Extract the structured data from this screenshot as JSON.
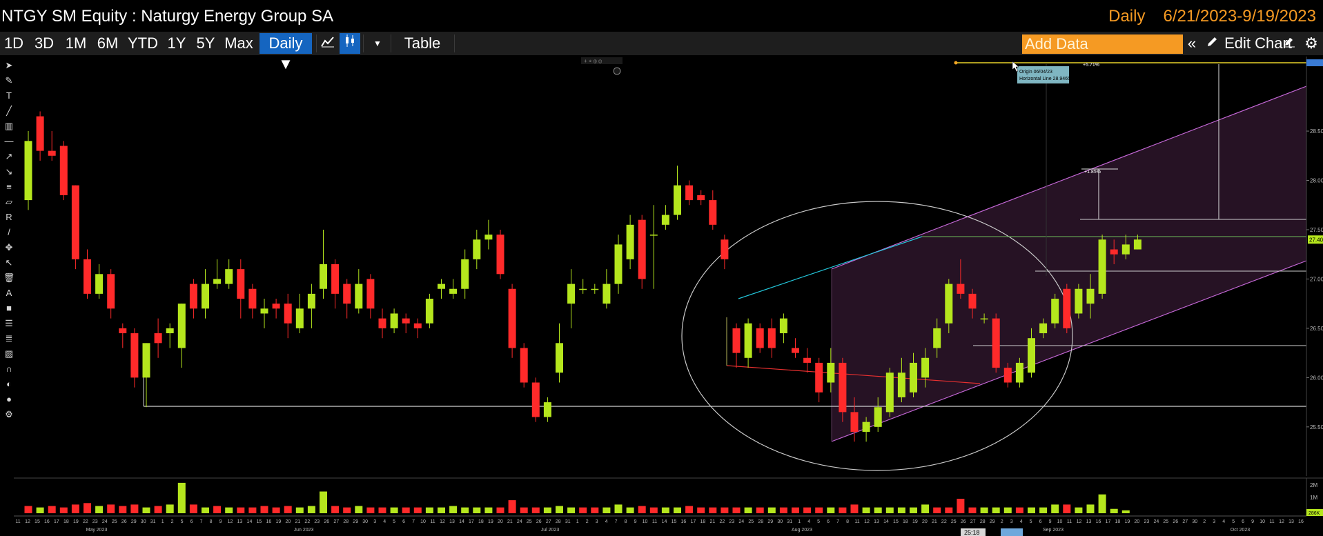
{
  "header": {
    "title": "NTGY SM Equity : Naturgy Energy Group SA",
    "frequency": "Daily",
    "date_range": "6/21/2023-9/19/2023"
  },
  "toolbar": {
    "ranges": [
      "1D",
      "3D",
      "1M",
      "6M",
      "YTD",
      "1Y",
      "5Y",
      "Max"
    ],
    "frequency_dropdown": "Daily ▼",
    "table_label": "Table",
    "add_data_placeholder": "Add Data",
    "edit_chart_label": "Edit Chart"
  },
  "colors": {
    "up": "#b5e61d",
    "down": "#ff2a2a",
    "accent": "#1565c0",
    "add_data_bg": "#f59a23",
    "channel": "#c266d4",
    "ellipse": "#c8c8c8"
  },
  "icons": [
    "line-chart-icon",
    "candle-chart-icon",
    "dropdown-arrow-icon",
    "collapse-icon",
    "pencil-icon",
    "edit-icon",
    "gear-icon"
  ],
  "annotations": {
    "origin_label": "Origin 06/04/23",
    "horizontal_line_label": "Horizontal Line 28.9465",
    "pct_top": "+5.71%",
    "pct_mid": "+1.85%",
    "time_marker": "25:18"
  },
  "chart_data": {
    "type": "candlestick",
    "y_ticks": [
      "28.50",
      "28.00",
      "27.50",
      "27.00",
      "26.50",
      "26.00",
      "25.50"
    ],
    "y_range": [
      25.1,
      29.2
    ],
    "last_price": "27.40",
    "month_labels": [
      "May 2023",
      "Jun 2023",
      "Jul 2023",
      "Aug 2023",
      "Sep 2023",
      "Oct 2023"
    ],
    "x_ticks": [
      "11",
      "12",
      "15",
      "16",
      "17",
      "18",
      "19",
      "22",
      "23",
      "24",
      "25",
      "26",
      "29",
      "30",
      "31",
      "1",
      "2",
      "5",
      "6",
      "7",
      "8",
      "9",
      "12",
      "13",
      "14",
      "15",
      "16",
      "19",
      "20",
      "21",
      "22",
      "23",
      "26",
      "27",
      "28",
      "29",
      "30",
      "3",
      "4",
      "5",
      "6",
      "7",
      "10",
      "11",
      "12",
      "13",
      "14",
      "17",
      "18",
      "19",
      "20",
      "21",
      "24",
      "25",
      "26",
      "27",
      "28",
      "31",
      "1",
      "2",
      "3",
      "4",
      "7",
      "8",
      "9",
      "10",
      "11",
      "14",
      "15",
      "16",
      "17",
      "18",
      "21",
      "22",
      "23",
      "24",
      "25",
      "28",
      "29",
      "30",
      "31",
      "1",
      "4",
      "5",
      "6",
      "7",
      "8",
      "11",
      "12",
      "13",
      "14",
      "15",
      "18",
      "19",
      "20",
      "21",
      "22",
      "25",
      "26",
      "27",
      "28",
      "29",
      "2",
      "3",
      "4",
      "5",
      "6",
      "9",
      "10",
      "11",
      "12",
      "13",
      "16",
      "17",
      "18",
      "19",
      "20",
      "23",
      "24",
      "25",
      "26",
      "27",
      "30",
      "2",
      "3",
      "4",
      "5",
      "6",
      "9",
      "10",
      "11",
      "12",
      "13",
      "16"
    ],
    "volume_ticks": [
      "2M",
      "1M"
    ],
    "volume_last": "286K",
    "candles": [
      {
        "o": 27.8,
        "c": 28.4,
        "h": 28.5,
        "l": 27.7
      },
      {
        "o": 28.65,
        "c": 28.3,
        "h": 28.7,
        "l": 28.2
      },
      {
        "o": 28.3,
        "c": 28.25,
        "h": 28.5,
        "l": 28.2
      },
      {
        "o": 28.35,
        "c": 27.85,
        "h": 28.4,
        "l": 27.8
      },
      {
        "o": 27.95,
        "c": 27.2,
        "h": 27.95,
        "l": 27.1
      },
      {
        "o": 27.2,
        "c": 26.85,
        "h": 27.3,
        "l": 26.8
      },
      {
        "o": 26.85,
        "c": 27.05,
        "h": 27.15,
        "l": 26.8
      },
      {
        "o": 27.05,
        "c": 26.7,
        "h": 27.1,
        "l": 26.6
      },
      {
        "o": 26.5,
        "c": 26.45,
        "h": 26.55,
        "l": 26.3
      },
      {
        "o": 26.45,
        "c": 26.0,
        "h": 26.5,
        "l": 25.9
      },
      {
        "o": 26.0,
        "c": 26.35,
        "h": 26.35,
        "l": 25.7
      },
      {
        "o": 26.45,
        "c": 26.35,
        "h": 26.6,
        "l": 26.2
      },
      {
        "o": 26.45,
        "c": 26.5,
        "h": 26.55,
        "l": 26.3
      },
      {
        "o": 26.3,
        "c": 26.75,
        "h": 26.75,
        "l": 26.1
      },
      {
        "o": 26.95,
        "c": 26.7,
        "h": 27.0,
        "l": 26.6
      },
      {
        "o": 26.7,
        "c": 26.95,
        "h": 27.1,
        "l": 26.6
      },
      {
        "o": 26.95,
        "c": 27.0,
        "h": 27.2,
        "l": 26.9
      },
      {
        "o": 26.95,
        "c": 27.1,
        "h": 27.2,
        "l": 26.9
      },
      {
        "o": 27.1,
        "c": 26.8,
        "h": 27.2,
        "l": 26.6
      },
      {
        "o": 26.9,
        "c": 26.7,
        "h": 26.95,
        "l": 26.6
      },
      {
        "o": 26.65,
        "c": 26.7,
        "h": 26.8,
        "l": 26.5
      },
      {
        "o": 26.75,
        "c": 26.7,
        "h": 26.8,
        "l": 26.6
      },
      {
        "o": 26.75,
        "c": 26.55,
        "h": 26.85,
        "l": 26.4
      },
      {
        "o": 26.5,
        "c": 26.7,
        "h": 26.85,
        "l": 26.45
      },
      {
        "o": 26.7,
        "c": 26.85,
        "h": 26.95,
        "l": 26.5
      },
      {
        "o": 26.9,
        "c": 27.15,
        "h": 27.5,
        "l": 26.8
      },
      {
        "o": 27.15,
        "c": 26.85,
        "h": 27.2,
        "l": 26.7
      },
      {
        "o": 26.95,
        "c": 26.75,
        "h": 27.0,
        "l": 26.6
      },
      {
        "o": 26.7,
        "c": 26.95,
        "h": 27.1,
        "l": 26.65
      },
      {
        "o": 27.0,
        "c": 26.7,
        "h": 27.05,
        "l": 26.6
      },
      {
        "o": 26.6,
        "c": 26.5,
        "h": 26.7,
        "l": 26.4
      },
      {
        "o": 26.5,
        "c": 26.65,
        "h": 26.7,
        "l": 26.45
      },
      {
        "o": 26.6,
        "c": 26.55,
        "h": 26.65,
        "l": 26.45
      },
      {
        "o": 26.55,
        "c": 26.5,
        "h": 26.6,
        "l": 26.4
      },
      {
        "o": 26.55,
        "c": 26.8,
        "h": 26.85,
        "l": 26.5
      },
      {
        "o": 26.9,
        "c": 26.95,
        "h": 27.0,
        "l": 26.8
      },
      {
        "o": 26.85,
        "c": 26.9,
        "h": 27.0,
        "l": 26.8
      },
      {
        "o": 26.9,
        "c": 27.2,
        "h": 27.3,
        "l": 26.8
      },
      {
        "o": 27.2,
        "c": 27.4,
        "h": 27.5,
        "l": 27.1
      },
      {
        "o": 27.4,
        "c": 27.45,
        "h": 27.6,
        "l": 27.3
      },
      {
        "o": 27.45,
        "c": 27.05,
        "h": 27.5,
        "l": 27.0
      },
      {
        "o": 26.9,
        "c": 26.3,
        "h": 26.95,
        "l": 26.2
      },
      {
        "o": 26.3,
        "c": 25.95,
        "h": 26.35,
        "l": 25.9
      },
      {
        "o": 25.95,
        "c": 25.6,
        "h": 26.0,
        "l": 25.55
      },
      {
        "o": 25.6,
        "c": 25.75,
        "h": 25.8,
        "l": 25.55
      },
      {
        "o": 26.05,
        "c": 26.35,
        "h": 26.55,
        "l": 25.95
      },
      {
        "o": 26.75,
        "c": 26.95,
        "h": 27.1,
        "l": 26.5
      },
      {
        "o": 26.9,
        "c": 26.9,
        "h": 27.0,
        "l": 26.85
      },
      {
        "o": 26.9,
        "c": 26.9,
        "h": 26.95,
        "l": 26.85
      },
      {
        "o": 26.75,
        "c": 26.95,
        "h": 27.1,
        "l": 26.7
      },
      {
        "o": 26.95,
        "c": 27.35,
        "h": 27.45,
        "l": 26.85
      },
      {
        "o": 27.2,
        "c": 27.55,
        "h": 27.65,
        "l": 27.1
      },
      {
        "o": 27.6,
        "c": 27.0,
        "h": 27.65,
        "l": 26.9
      },
      {
        "o": 27.45,
        "c": 27.45,
        "h": 27.75,
        "l": 26.9
      },
      {
        "o": 27.55,
        "c": 27.65,
        "h": 27.75,
        "l": 27.5
      },
      {
        "o": 27.65,
        "c": 27.95,
        "h": 28.15,
        "l": 27.6
      },
      {
        "o": 27.95,
        "c": 27.8,
        "h": 28.0,
        "l": 27.75
      },
      {
        "o": 27.85,
        "c": 27.8,
        "h": 27.9,
        "l": 27.75
      },
      {
        "o": 27.8,
        "c": 27.55,
        "h": 27.9,
        "l": 27.5
      },
      {
        "o": 27.4,
        "c": 27.2,
        "h": 27.45,
        "l": 27.1
      },
      {
        "o": 26.5,
        "c": 26.25,
        "h": 26.55,
        "l": 26.1
      },
      {
        "o": 26.2,
        "c": 26.55,
        "h": 26.6,
        "l": 26.1
      },
      {
        "o": 26.5,
        "c": 26.3,
        "h": 26.55,
        "l": 26.25
      },
      {
        "o": 26.5,
        "c": 26.3,
        "h": 26.6,
        "l": 26.2
      },
      {
        "o": 26.45,
        "c": 26.6,
        "h": 26.65,
        "l": 26.35
      },
      {
        "o": 26.3,
        "c": 26.25,
        "h": 26.4,
        "l": 26.2
      },
      {
        "o": 26.2,
        "c": 26.15,
        "h": 26.3,
        "l": 26.05
      },
      {
        "o": 26.15,
        "c": 25.85,
        "h": 26.2,
        "l": 25.75
      },
      {
        "o": 25.95,
        "c": 26.15,
        "h": 26.3,
        "l": 25.85
      },
      {
        "o": 26.15,
        "c": 25.65,
        "h": 26.2,
        "l": 25.55
      },
      {
        "o": 25.65,
        "c": 25.45,
        "h": 25.8,
        "l": 25.35
      },
      {
        "o": 25.45,
        "c": 25.55,
        "h": 25.6,
        "l": 25.35
      },
      {
        "o": 25.5,
        "c": 25.7,
        "h": 25.8,
        "l": 25.45
      },
      {
        "o": 25.65,
        "c": 26.05,
        "h": 26.1,
        "l": 25.6
      },
      {
        "o": 25.8,
        "c": 26.05,
        "h": 26.2,
        "l": 25.75
      },
      {
        "o": 25.85,
        "c": 26.15,
        "h": 26.25,
        "l": 25.8
      },
      {
        "o": 26.0,
        "c": 26.2,
        "h": 26.3,
        "l": 25.9
      },
      {
        "o": 26.3,
        "c": 26.5,
        "h": 26.6,
        "l": 26.2
      },
      {
        "o": 26.55,
        "c": 26.95,
        "h": 27.0,
        "l": 26.45
      },
      {
        "o": 26.95,
        "c": 26.85,
        "h": 27.2,
        "l": 26.8
      },
      {
        "o": 26.85,
        "c": 26.7,
        "h": 26.9,
        "l": 26.6
      },
      {
        "o": 26.6,
        "c": 26.6,
        "h": 26.65,
        "l": 26.55
      },
      {
        "o": 26.6,
        "c": 26.1,
        "h": 26.65,
        "l": 26.05
      },
      {
        "o": 26.1,
        "c": 25.95,
        "h": 26.15,
        "l": 25.9
      },
      {
        "o": 25.95,
        "c": 26.15,
        "h": 26.2,
        "l": 25.9
      },
      {
        "o": 26.05,
        "c": 26.4,
        "h": 26.5,
        "l": 26.0
      },
      {
        "o": 26.45,
        "c": 26.55,
        "h": 26.6,
        "l": 26.4
      },
      {
        "o": 26.55,
        "c": 26.8,
        "h": 26.85,
        "l": 26.5
      },
      {
        "o": 26.9,
        "c": 26.5,
        "h": 26.95,
        "l": 26.45
      },
      {
        "o": 26.65,
        "c": 26.9,
        "h": 26.95,
        "l": 26.6
      },
      {
        "o": 26.75,
        "c": 26.9,
        "h": 27.05,
        "l": 26.6
      },
      {
        "o": 26.85,
        "c": 27.4,
        "h": 27.45,
        "l": 26.8
      },
      {
        "o": 27.3,
        "c": 27.25,
        "h": 27.4,
        "l": 27.15
      },
      {
        "o": 27.25,
        "c": 27.35,
        "h": 27.45,
        "l": 27.2
      },
      {
        "o": 27.3,
        "c": 27.4,
        "h": 27.45,
        "l": 27.3
      }
    ],
    "volume": [
      {
        "v": 0.25,
        "up": false
      },
      {
        "v": 0.2,
        "up": true
      },
      {
        "v": 0.25,
        "up": false
      },
      {
        "v": 0.2,
        "up": false
      },
      {
        "v": 0.3,
        "up": false
      },
      {
        "v": 0.35,
        "up": false
      },
      {
        "v": 0.25,
        "up": true
      },
      {
        "v": 0.3,
        "up": false
      },
      {
        "v": 0.25,
        "up": false
      },
      {
        "v": 0.3,
        "up": false
      },
      {
        "v": 0.2,
        "up": true
      },
      {
        "v": 0.25,
        "up": false
      },
      {
        "v": 0.3,
        "up": true
      },
      {
        "v": 1.05,
        "up": true
      },
      {
        "v": 0.3,
        "up": false
      },
      {
        "v": 0.2,
        "up": true
      },
      {
        "v": 0.25,
        "up": false
      },
      {
        "v": 0.2,
        "up": true
      },
      {
        "v": 0.2,
        "up": false
      },
      {
        "v": 0.2,
        "up": false
      },
      {
        "v": 0.25,
        "up": false
      },
      {
        "v": 0.2,
        "up": false
      },
      {
        "v": 0.25,
        "up": false
      },
      {
        "v": 0.2,
        "up": true
      },
      {
        "v": 0.25,
        "up": true
      },
      {
        "v": 0.75,
        "up": true
      },
      {
        "v": 0.25,
        "up": false
      },
      {
        "v": 0.2,
        "up": false
      },
      {
        "v": 0.25,
        "up": true
      },
      {
        "v": 0.2,
        "up": false
      },
      {
        "v": 0.2,
        "up": false
      },
      {
        "v": 0.2,
        "up": true
      },
      {
        "v": 0.2,
        "up": false
      },
      {
        "v": 0.2,
        "up": false
      },
      {
        "v": 0.2,
        "up": true
      },
      {
        "v": 0.2,
        "up": true
      },
      {
        "v": 0.25,
        "up": true
      },
      {
        "v": 0.2,
        "up": true
      },
      {
        "v": 0.2,
        "up": true
      },
      {
        "v": 0.2,
        "up": true
      },
      {
        "v": 0.2,
        "up": false
      },
      {
        "v": 0.45,
        "up": false
      },
      {
        "v": 0.2,
        "up": false
      },
      {
        "v": 0.2,
        "up": false
      },
      {
        "v": 0.2,
        "up": true
      },
      {
        "v": 0.25,
        "up": true
      },
      {
        "v": 0.2,
        "up": true
      },
      {
        "v": 0.2,
        "up": false
      },
      {
        "v": 0.2,
        "up": false
      },
      {
        "v": 0.2,
        "up": true
      },
      {
        "v": 0.3,
        "up": true
      },
      {
        "v": 0.2,
        "up": true
      },
      {
        "v": 0.25,
        "up": false
      },
      {
        "v": 0.2,
        "up": false
      },
      {
        "v": 0.2,
        "up": true
      },
      {
        "v": 0.2,
        "up": true
      },
      {
        "v": 0.25,
        "up": false
      },
      {
        "v": 0.2,
        "up": false
      },
      {
        "v": 0.2,
        "up": false
      },
      {
        "v": 0.2,
        "up": false
      },
      {
        "v": 0.2,
        "up": false
      },
      {
        "v": 0.2,
        "up": true
      },
      {
        "v": 0.2,
        "up": false
      },
      {
        "v": 0.2,
        "up": true
      },
      {
        "v": 0.2,
        "up": false
      },
      {
        "v": 0.2,
        "up": false
      },
      {
        "v": 0.2,
        "up": false
      },
      {
        "v": 0.2,
        "up": false
      },
      {
        "v": 0.2,
        "up": true
      },
      {
        "v": 0.2,
        "up": false
      },
      {
        "v": 0.3,
        "up": false
      },
      {
        "v": 0.2,
        "up": true
      },
      {
        "v": 0.2,
        "up": true
      },
      {
        "v": 0.2,
        "up": true
      },
      {
        "v": 0.2,
        "up": true
      },
      {
        "v": 0.2,
        "up": true
      },
      {
        "v": 0.3,
        "up": true
      },
      {
        "v": 0.2,
        "up": false
      },
      {
        "v": 0.2,
        "up": false
      },
      {
        "v": 0.5,
        "up": false
      },
      {
        "v": 0.2,
        "up": false
      },
      {
        "v": 0.2,
        "up": true
      },
      {
        "v": 0.2,
        "up": true
      },
      {
        "v": 0.2,
        "up": true
      },
      {
        "v": 0.2,
        "up": false
      },
      {
        "v": 0.2,
        "up": true
      },
      {
        "v": 0.2,
        "up": true
      },
      {
        "v": 0.3,
        "up": true
      },
      {
        "v": 0.3,
        "up": false
      },
      {
        "v": 0.2,
        "up": true
      },
      {
        "v": 0.3,
        "up": true
      },
      {
        "v": 0.65,
        "up": true
      },
      {
        "v": 0.15,
        "up": true
      },
      {
        "v": 0.1,
        "up": true
      }
    ]
  }
}
